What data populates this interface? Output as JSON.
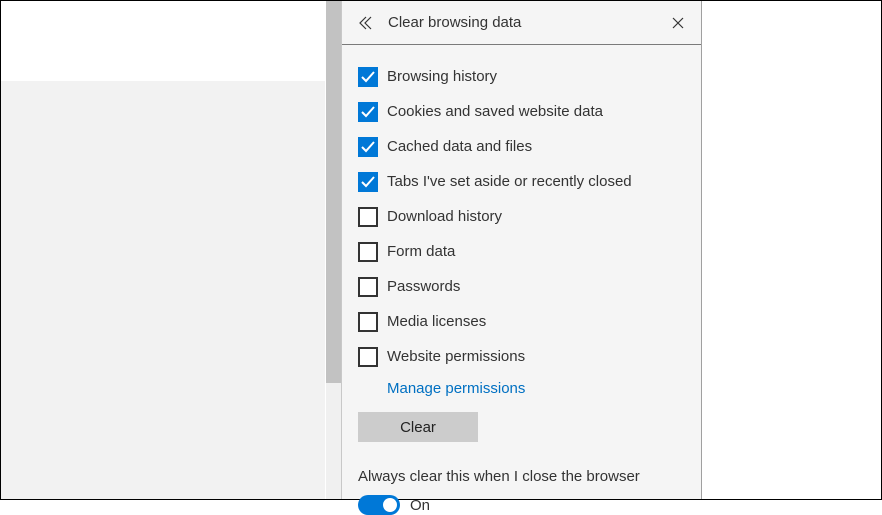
{
  "header": {
    "title": "Clear browsing data"
  },
  "items": [
    {
      "label": "Browsing history",
      "checked": true
    },
    {
      "label": "Cookies and saved website data",
      "checked": true
    },
    {
      "label": "Cached data and files",
      "checked": true
    },
    {
      "label": "Tabs I've set aside or recently closed",
      "checked": true
    },
    {
      "label": "Download history",
      "checked": false
    },
    {
      "label": "Form data",
      "checked": false
    },
    {
      "label": "Passwords",
      "checked": false
    },
    {
      "label": "Media licenses",
      "checked": false
    },
    {
      "label": "Website permissions",
      "checked": false
    }
  ],
  "manage_link": "Manage permissions",
  "clear_button": "Clear",
  "always_clear": {
    "label": "Always clear this when I close the browser",
    "state_label": "On",
    "on": true
  },
  "colors": {
    "accent": "#0078d7",
    "link": "#0070c2"
  }
}
